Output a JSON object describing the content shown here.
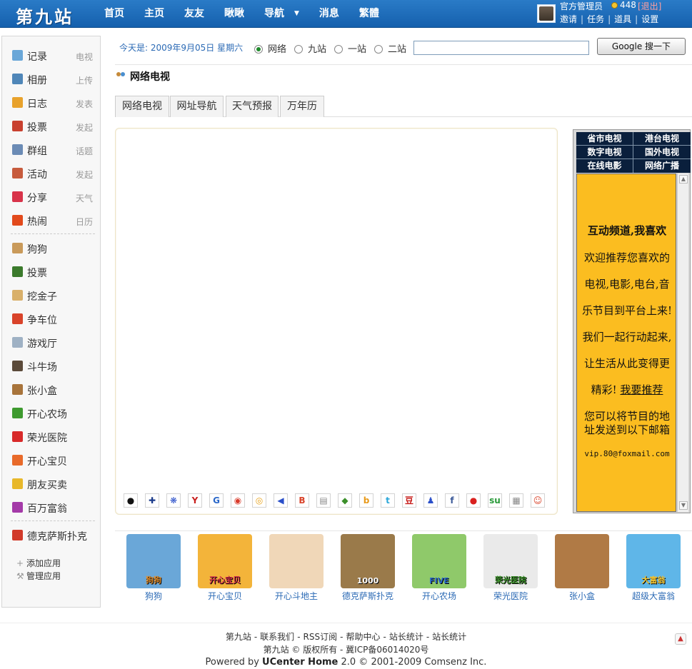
{
  "header": {
    "logo": "第九站",
    "nav": [
      "首页",
      "主页",
      "友友",
      "瞅瞅",
      "导航",
      "消息",
      "繁體"
    ],
    "user": {
      "name": "官方管理员",
      "credit": "448",
      "logout": "[退出]",
      "links": [
        "邀请",
        "任务",
        "道具",
        "设置"
      ]
    }
  },
  "sidebar": {
    "main": [
      {
        "label": "记录",
        "action": "电视",
        "icon": "speech-bubble-icon",
        "color": "#6aa7d8"
      },
      {
        "label": "相册",
        "action": "上传",
        "icon": "photo-album-icon",
        "color": "#4f86b8"
      },
      {
        "label": "日志",
        "action": "发表",
        "icon": "diary-icon",
        "color": "#e8a22c"
      },
      {
        "label": "投票",
        "action": "发起",
        "icon": "poll-chart-icon",
        "color": "#c8402f"
      },
      {
        "label": "群组",
        "action": "话题",
        "icon": "group-icon",
        "color": "#6b8bb5"
      },
      {
        "label": "活动",
        "action": "发起",
        "icon": "calendar-icon",
        "color": "#c75b3d"
      },
      {
        "label": "分享",
        "action": "天气",
        "icon": "heart-share-icon",
        "color": "#d8334a"
      },
      {
        "label": "热闹",
        "action": "日历",
        "icon": "flame-icon",
        "color": "#e24a1c"
      }
    ],
    "apps": [
      {
        "label": "狗狗",
        "icon": "dog-app-icon",
        "color": "#c99a5a"
      },
      {
        "label": "投票",
        "icon": "poll-app-icon",
        "color": "#3b7a2c"
      },
      {
        "label": "挖金子",
        "icon": "gold-dig-icon",
        "color": "#d9b06a"
      },
      {
        "label": "争车位",
        "icon": "parking-icon",
        "color": "#d9432a"
      },
      {
        "label": "游戏厅",
        "icon": "game-hall-icon",
        "color": "#9fb1c4"
      },
      {
        "label": "斗牛场",
        "icon": "bull-icon",
        "color": "#5b4a3a"
      },
      {
        "label": "张小盒",
        "icon": "box-man-icon",
        "color": "#a8743b"
      },
      {
        "label": "开心农场",
        "icon": "farm-sprout-icon",
        "color": "#3e9a2f"
      },
      {
        "label": "荣光医院",
        "icon": "hospital-cross-icon",
        "color": "#d82a2a"
      },
      {
        "label": "开心宝贝",
        "icon": "baby-pet-icon",
        "color": "#e86a2a"
      },
      {
        "label": "朋友买卖",
        "icon": "coins-icon",
        "color": "#e8b82a"
      },
      {
        "label": "百万富翁",
        "icon": "star-rich-icon",
        "color": "#a43aa8"
      }
    ],
    "extra": {
      "label": "德克萨斯扑克",
      "icon": "poker-chip-icon",
      "color": "#d13a2a"
    },
    "add_app": "添加应用",
    "manage_app": "管理应用"
  },
  "search": {
    "today": "今天是: 2009年9月05日 星期六",
    "options": [
      "网络",
      "九站",
      "一站",
      "二站"
    ],
    "selected": "网络",
    "value": "",
    "button": "Google 搜一下"
  },
  "section": {
    "title": "网络电视"
  },
  "tabs": [
    "网络电视",
    "网址导航",
    "天气预报",
    "万年历"
  ],
  "site_icons": [
    {
      "name": "qq-icon",
      "glyph": "●",
      "color": "#111"
    },
    {
      "name": "cross-icon",
      "glyph": "✚",
      "color": "#1a3a8a"
    },
    {
      "name": "baidu-paw-icon",
      "glyph": "❋",
      "color": "#2a4fc9"
    },
    {
      "name": "yahoo-icon",
      "glyph": "Y",
      "color": "#c8201e"
    },
    {
      "name": "google-icon",
      "glyph": "G",
      "color": "#2a67c9"
    },
    {
      "name": "weibo-icon",
      "glyph": "◉",
      "color": "#d93a2a"
    },
    {
      "name": "sohu-icon",
      "glyph": "◎",
      "color": "#e8a21a"
    },
    {
      "name": "feed-icon",
      "glyph": "◀",
      "color": "#2a4fc9"
    },
    {
      "name": "blog-b-icon",
      "glyph": "B",
      "color": "#d9432a"
    },
    {
      "name": "print-icon",
      "glyph": "▤",
      "color": "#888"
    },
    {
      "name": "windows-icon",
      "glyph": "◆",
      "color": "#3b8f2a"
    },
    {
      "name": "bookmark-b-icon",
      "glyph": "b",
      "color": "#e89a1a"
    },
    {
      "name": "twitter-icon",
      "glyph": "t",
      "color": "#2aa7d9"
    },
    {
      "name": "douban-icon",
      "glyph": "豆",
      "color": "#c8201e"
    },
    {
      "name": "people-icon",
      "glyph": "♟",
      "color": "#2a4fc9"
    },
    {
      "name": "facebook-icon",
      "glyph": "f",
      "color": "#3b5998"
    },
    {
      "name": "ask-icon",
      "glyph": "●",
      "color": "#d9201e"
    },
    {
      "name": "stumble-icon",
      "glyph": "su",
      "color": "#2a9a3a"
    },
    {
      "name": "digg-icon",
      "glyph": "▦",
      "color": "#888"
    },
    {
      "name": "reddit-icon",
      "glyph": "☺",
      "color": "#d9432a"
    }
  ],
  "right_panel": {
    "channels": [
      "省市电视",
      "港台电视",
      "数字电视",
      "国外电视",
      "在线电影",
      "网络广播"
    ],
    "promo": {
      "title": "互动频道,我喜欢",
      "lines": [
        "欢迎推荐您喜欢的",
        "电视,电影,电台,音",
        "乐节目到平台上来!",
        "我们一起行动起来,",
        "让生活从此变得更"
      ],
      "last_prefix": "精彩!",
      "link": "我要推荐",
      "mail_lines": [
        "您可以将节目的地",
        "址发送到以下邮箱"
      ],
      "email": "vip.80@foxmail.com"
    }
  },
  "apps": [
    {
      "name": "狗狗",
      "art": "狗狗",
      "color": "#6aa7d8",
      "art_color": "#e8902a"
    },
    {
      "name": "开心宝贝",
      "art": "开心宝贝",
      "color": "#f3b43a",
      "art_color": "#d8334a"
    },
    {
      "name": "开心斗地主",
      "art": "",
      "color": "#f0d7b8",
      "art_color": "#d8334a"
    },
    {
      "name": "德克萨斯扑克",
      "art": "1000",
      "color": "#9a7a4a",
      "art_color": "#fff"
    },
    {
      "name": "开心农场",
      "art": "FIVE",
      "color": "#8fc96a",
      "art_color": "#2a67c9"
    },
    {
      "name": "荣光医院",
      "art": "荣光医院",
      "color": "#eaeaea",
      "art_color": "#3b8f2a"
    },
    {
      "name": "张小盒",
      "art": "",
      "color": "#b07a45",
      "art_color": "#222"
    },
    {
      "name": "超级大富翁",
      "art": "大富翁",
      "color": "#5fb6e8",
      "art_color": "#f3c431"
    }
  ],
  "footer": {
    "links": [
      "第九站",
      "联系我们",
      "RSS订阅",
      "帮助中心",
      "站长统计",
      "站长统计"
    ],
    "copyright": "第九站 © 版权所有 - 冀ICP备06014020号",
    "powered_prefix": "Powered by",
    "powered_name": "UCenter Home",
    "powered_suffix": "2.0 © 2001-2009 Comsenz Inc."
  }
}
